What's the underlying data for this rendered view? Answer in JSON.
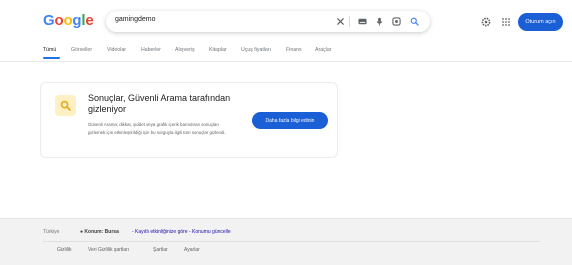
{
  "header": {
    "logo_letters": [
      {
        "char": "G",
        "color": "#4285f4"
      },
      {
        "char": "o",
        "color": "#ea4335"
      },
      {
        "char": "o",
        "color": "#fbbc05"
      },
      {
        "char": "g",
        "color": "#4285f4"
      },
      {
        "char": "l",
        "color": "#34a853"
      },
      {
        "char": "e",
        "color": "#ea4335"
      }
    ],
    "search_query": "gamingdemo",
    "icons": {
      "clear": "close-icon",
      "keyboard": "keyboard-icon",
      "voice": "microphone-icon",
      "lens": "camera-lens-icon",
      "search": "search-icon",
      "settings": "gear-icon",
      "apps": "apps-grid-icon"
    },
    "signin_label": "Oturum açın"
  },
  "tabs": [
    "Tümü",
    "Görseller",
    "Videolar",
    "Haberler",
    "Alışveriş",
    "Kitaplar",
    "Uçuş fiyatları",
    "Finans",
    "Araçlar"
  ],
  "card": {
    "icon": "search-icon",
    "title": "Sonuçlar, Güvenli Arama tarafından gizleniyor",
    "description": "Güvenli Arama; dikkat, şiddet veya grafik içerik barındıran sonuçları gizlemek için etkinleştirildiği için bu sorguyla ilgili tüm sonuçlar gizlendi.",
    "button_label": "Daha fazla bilgi edinin"
  },
  "footer": {
    "country": "Türkiye",
    "location_bold": "● Konum: Bursa",
    "location_link": "- Kayıtlı etkinliğinize göre - Konumu güncelle",
    "links": [
      "Gizlilik",
      "Veri Gizlilik şartları",
      "Şartlar",
      "Ayarlar"
    ]
  },
  "colors": {
    "accent": "#1a5fd6",
    "tab_active_underline": "#1a73e8",
    "card_icon_bg": "#fdf0c3",
    "footer_bg": "#f2f2f2"
  }
}
